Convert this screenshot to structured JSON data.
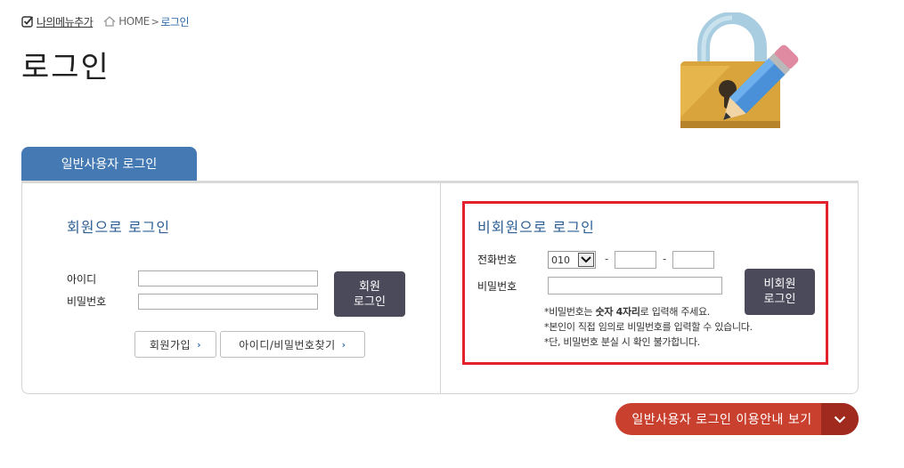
{
  "top": {
    "my_menu_label": "나의메뉴추가",
    "breadcrumb_home": "HOME",
    "breadcrumb_separator": ">",
    "breadcrumb_current": "로그인"
  },
  "page_title": "로그인",
  "tab_label": "일반사용자 로그인",
  "member_login": {
    "title": "회원으로 로그인",
    "id_label": "아이디",
    "password_label": "비밀번호",
    "id_value": "",
    "password_value": "",
    "login_button_line1": "회원",
    "login_button_line2": "로그인",
    "signup_button": "회원가입",
    "find_account_button": "아이디/비밀번호찾기"
  },
  "guest_login": {
    "title": "비회원으로 로그인",
    "phone_label": "전화번호",
    "phone_prefix_selected": "010",
    "phone_separator": "-",
    "phone_mid_value": "",
    "phone_last_value": "",
    "password_label": "비밀번호",
    "password_value": "",
    "login_button_line1": "비회원",
    "login_button_line2": "로그인",
    "note1_prefix": "*비밀번호는 ",
    "note1_bold": "숫자 4자리",
    "note1_suffix": "로 입력해 주세요.",
    "note2": "*본인이 직접 임의로 비밀번호를 입력할 수 있습니다.",
    "note3": "*단, 비밀번호 분실 시 확인 불가합니다."
  },
  "guide_button_label": "일반사용자 로그인 이용안내 보기",
  "colors": {
    "tab_blue": "#4479b3",
    "title_blue": "#2d5f94",
    "dark_button": "#4b4a5a",
    "highlight_red": "#e3212d",
    "guide_red": "#c9402e",
    "guide_dark_red": "#a12a1e"
  },
  "icons": {
    "my_menu": "checkbox-icon",
    "home": "home-icon",
    "illustration": "padlock-pencil-illustration",
    "arrow": "chevron-right-icon",
    "dropdown": "chevron-down-icon"
  }
}
